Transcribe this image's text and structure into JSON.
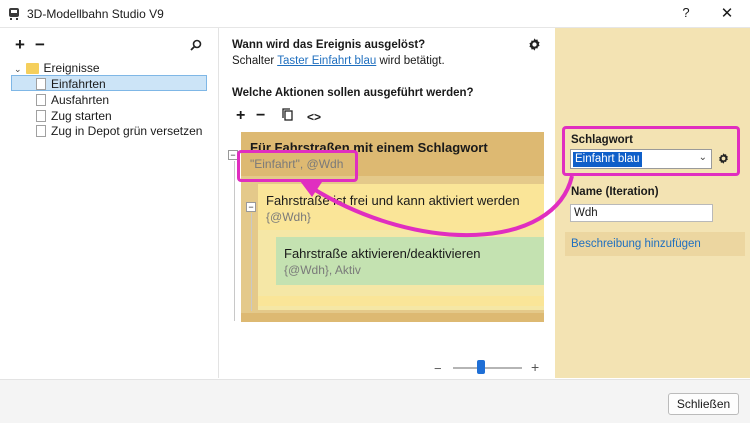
{
  "window": {
    "title": "3D-Modellbahn Studio V9",
    "help_label": "?",
    "close_label": "✕"
  },
  "tree_toolbar": {
    "add_label": "+",
    "remove_label": "−",
    "search_icon": "search-icon"
  },
  "tree": {
    "root": "Ereignisse",
    "items": [
      {
        "label": "Einfahrten",
        "selected": true
      },
      {
        "label": "Ausfahrten"
      },
      {
        "label": "Zug starten"
      },
      {
        "label": "Zug in Depot grün versetzen"
      }
    ]
  },
  "trigger": {
    "heading": "Wann wird das Ereignis ausgelöst?",
    "prefix": "Schalter",
    "link": "Taster Einfahrt blau",
    "suffix": "wird betätigt."
  },
  "actions": {
    "heading": "Welche Aktionen sollen ausgeführt werden?",
    "toolbar": {
      "add": "+",
      "remove": "−",
      "code": "<>"
    }
  },
  "blocks": {
    "outer_title": "Für Fahrstraßen mit einem Schlagwort",
    "outer_params": "\"Einfahrt\", @Wdh",
    "inner_title": "Fahrstraße ist frei und kann aktiviert werden",
    "inner_params": "{@Wdh}",
    "action_title": "Fahrstraße aktivieren/deaktivieren",
    "action_params": "{@Wdh}, Aktiv"
  },
  "properties": {
    "tag_label": "Schlagwort",
    "tag_value": "Einfahrt blau",
    "name_label": "Name (Iteration)",
    "name_value": "Wdh",
    "desc_link": "Beschreibung hinzufügen"
  },
  "zoom": {
    "minus": "−",
    "plus": "+",
    "level": 0.35
  },
  "footer": {
    "close": "Schließen"
  },
  "colors": {
    "highlight": "#e02ec0",
    "link": "#1f6fbf",
    "outer_block": "#ddb972",
    "condition_block": "#fae598",
    "action_block": "#c4e2b1",
    "properties_panel": "#f3e3b3"
  }
}
